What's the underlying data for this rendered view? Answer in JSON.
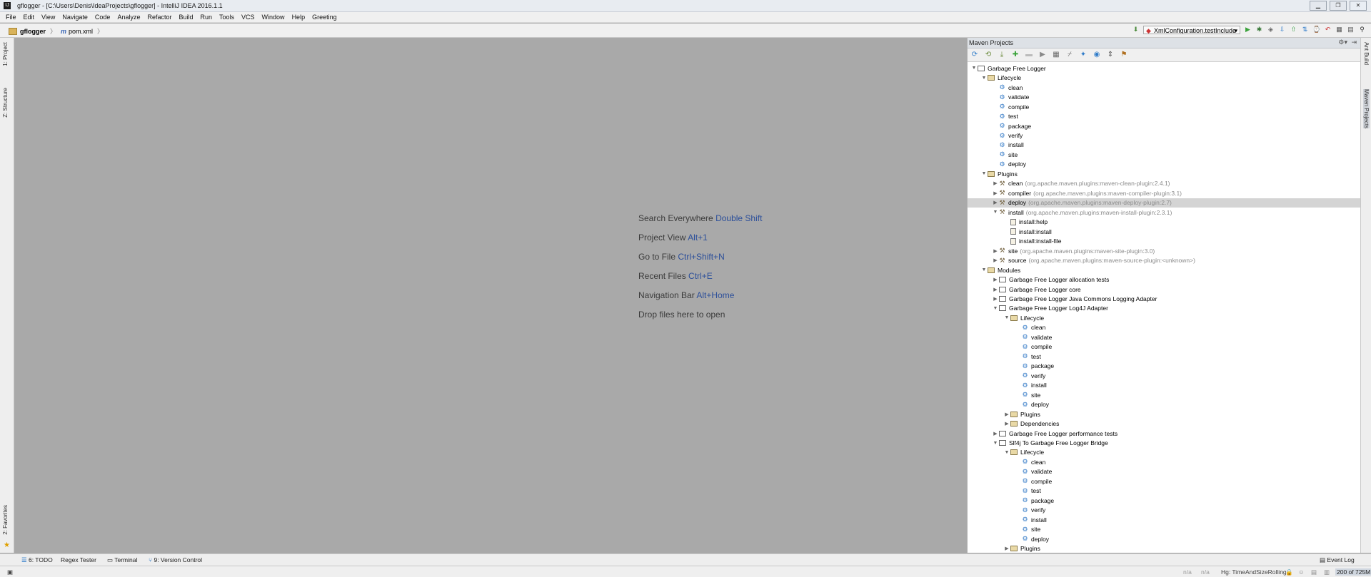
{
  "window": {
    "title": "gflogger - [C:\\Users\\Denis\\IdeaProjects\\gflogger] - IntelliJ IDEA 2016.1.1"
  },
  "menu": [
    "File",
    "Edit",
    "View",
    "Navigate",
    "Code",
    "Analyze",
    "Refactor",
    "Build",
    "Run",
    "Tools",
    "VCS",
    "Window",
    "Help",
    "Greeting"
  ],
  "breadcrumbs": {
    "project": "gflogger",
    "file": "pom.xml",
    "file_prefix": "m"
  },
  "toolbar": {
    "run_config": "XmlConfiguration.testInclude"
  },
  "left_tabs": {
    "project": "1: Project",
    "structure": "Z: Structure",
    "favorites": "2: Favorites"
  },
  "editor_hints": [
    {
      "label": "Search Everywhere",
      "key": "Double Shift"
    },
    {
      "label": "Project View",
      "key": "Alt+1"
    },
    {
      "label": "Go to File",
      "key": "Ctrl+Shift+N"
    },
    {
      "label": "Recent Files",
      "key": "Ctrl+E"
    },
    {
      "label": "Navigation Bar",
      "key": "Alt+Home"
    },
    {
      "label": "Drop files here to open",
      "key": ""
    }
  ],
  "maven": {
    "title": "Maven Projects",
    "tree": [
      {
        "text": "Garbage Free Logger",
        "coord": "",
        "icon": "mod",
        "depth": 0,
        "expanded": true
      },
      {
        "text": "Lifecycle",
        "coord": "",
        "icon": "folder",
        "depth": 1,
        "expanded": true
      },
      {
        "text": "clean",
        "coord": "",
        "icon": "gear",
        "depth": 2
      },
      {
        "text": "validate",
        "coord": "",
        "icon": "gear",
        "depth": 2
      },
      {
        "text": "compile",
        "coord": "",
        "icon": "gear",
        "depth": 2
      },
      {
        "text": "test",
        "coord": "",
        "icon": "gear",
        "depth": 2
      },
      {
        "text": "package",
        "coord": "",
        "icon": "gear",
        "depth": 2
      },
      {
        "text": "verify",
        "coord": "",
        "icon": "gear",
        "depth": 2
      },
      {
        "text": "install",
        "coord": "",
        "icon": "gear",
        "depth": 2
      },
      {
        "text": "site",
        "coord": "",
        "icon": "gear",
        "depth": 2
      },
      {
        "text": "deploy",
        "coord": "",
        "icon": "gear",
        "depth": 2
      },
      {
        "text": "Plugins",
        "coord": "",
        "icon": "folder",
        "depth": 1,
        "expanded": true
      },
      {
        "text": "clean",
        "coord": "(org.apache.maven.plugins:maven-clean-plugin:2.4.1)",
        "icon": "plug",
        "depth": 2,
        "expanded": false
      },
      {
        "text": "compiler",
        "coord": "(org.apache.maven.plugins:maven-compiler-plugin:3.1)",
        "icon": "plug",
        "depth": 2,
        "expanded": false
      },
      {
        "text": "deploy",
        "coord": "(org.apache.maven.plugins:maven-deploy-plugin:2.7)",
        "icon": "plug",
        "depth": 2,
        "expanded": false,
        "selected": true
      },
      {
        "text": "install",
        "coord": "(org.apache.maven.plugins:maven-install-plugin:2.3.1)",
        "icon": "plug",
        "depth": 2,
        "expanded": true
      },
      {
        "text": "install:help",
        "coord": "",
        "icon": "goal",
        "depth": 3
      },
      {
        "text": "install:install",
        "coord": "",
        "icon": "goal",
        "depth": 3
      },
      {
        "text": "install:install-file",
        "coord": "",
        "icon": "goal",
        "depth": 3
      },
      {
        "text": "site",
        "coord": "(org.apache.maven.plugins:maven-site-plugin:3.0)",
        "icon": "plug",
        "depth": 2,
        "expanded": false
      },
      {
        "text": "source",
        "coord": "(org.apache.maven.plugins:maven-source-plugin:<unknown>)",
        "icon": "plug",
        "depth": 2,
        "expanded": false
      },
      {
        "text": "Modules",
        "coord": "",
        "icon": "folder",
        "depth": 1,
        "expanded": true
      },
      {
        "text": "Garbage Free Logger allocation tests",
        "coord": "",
        "icon": "mod",
        "depth": 2,
        "expanded": false
      },
      {
        "text": "Garbage Free Logger core",
        "coord": "",
        "icon": "mod",
        "depth": 2,
        "expanded": false
      },
      {
        "text": "Garbage Free Logger Java Commons Logging Adapter",
        "coord": "",
        "icon": "mod",
        "depth": 2,
        "expanded": false
      },
      {
        "text": "Garbage Free Logger Log4J Adapter",
        "coord": "",
        "icon": "mod",
        "depth": 2,
        "expanded": true
      },
      {
        "text": "Lifecycle",
        "coord": "",
        "icon": "folder",
        "depth": 3,
        "expanded": true
      },
      {
        "text": "clean",
        "coord": "",
        "icon": "gear",
        "depth": 4
      },
      {
        "text": "validate",
        "coord": "",
        "icon": "gear",
        "depth": 4
      },
      {
        "text": "compile",
        "coord": "",
        "icon": "gear",
        "depth": 4
      },
      {
        "text": "test",
        "coord": "",
        "icon": "gear",
        "depth": 4
      },
      {
        "text": "package",
        "coord": "",
        "icon": "gear",
        "depth": 4
      },
      {
        "text": "verify",
        "coord": "",
        "icon": "gear",
        "depth": 4
      },
      {
        "text": "install",
        "coord": "",
        "icon": "gear",
        "depth": 4
      },
      {
        "text": "site",
        "coord": "",
        "icon": "gear",
        "depth": 4
      },
      {
        "text": "deploy",
        "coord": "",
        "icon": "gear",
        "depth": 4
      },
      {
        "text": "Plugins",
        "coord": "",
        "icon": "folder",
        "depth": 3,
        "expanded": false
      },
      {
        "text": "Dependencies",
        "coord": "",
        "icon": "folder",
        "depth": 3,
        "expanded": false
      },
      {
        "text": "Garbage Free Logger performance tests",
        "coord": "",
        "icon": "mod",
        "depth": 2,
        "expanded": false
      },
      {
        "text": "Slf4j To Garbage Free Logger Bridge",
        "coord": "",
        "icon": "mod",
        "depth": 2,
        "expanded": true
      },
      {
        "text": "Lifecycle",
        "coord": "",
        "icon": "folder",
        "depth": 3,
        "expanded": true
      },
      {
        "text": "clean",
        "coord": "",
        "icon": "gear",
        "depth": 4
      },
      {
        "text": "validate",
        "coord": "",
        "icon": "gear",
        "depth": 4
      },
      {
        "text": "compile",
        "coord": "",
        "icon": "gear",
        "depth": 4
      },
      {
        "text": "test",
        "coord": "",
        "icon": "gear",
        "depth": 4
      },
      {
        "text": "package",
        "coord": "",
        "icon": "gear",
        "depth": 4
      },
      {
        "text": "verify",
        "coord": "",
        "icon": "gear",
        "depth": 4
      },
      {
        "text": "install",
        "coord": "",
        "icon": "gear",
        "depth": 4
      },
      {
        "text": "site",
        "coord": "",
        "icon": "gear",
        "depth": 4
      },
      {
        "text": "deploy",
        "coord": "",
        "icon": "gear",
        "depth": 4
      },
      {
        "text": "Plugins",
        "coord": "",
        "icon": "folder",
        "depth": 3,
        "expanded": false
      }
    ]
  },
  "right_tabs": {
    "ant": "Ant Build",
    "maven": "Maven Projects"
  },
  "bottom_tabs": {
    "todo": "6: TODO",
    "regex": "Regex Tester",
    "terminal": "Terminal",
    "vcs": "9: Version Control",
    "event_log": "Event Log"
  },
  "status": {
    "na1": "n/a",
    "na2": "n/a",
    "branch": "Hg: TimeAndSizeRolling",
    "memory": "200 of 725M"
  },
  "colors": {
    "hint_key": "#2c4f9a",
    "editor_bg": "#a9a9a9",
    "selection": "#d4d4d4"
  }
}
